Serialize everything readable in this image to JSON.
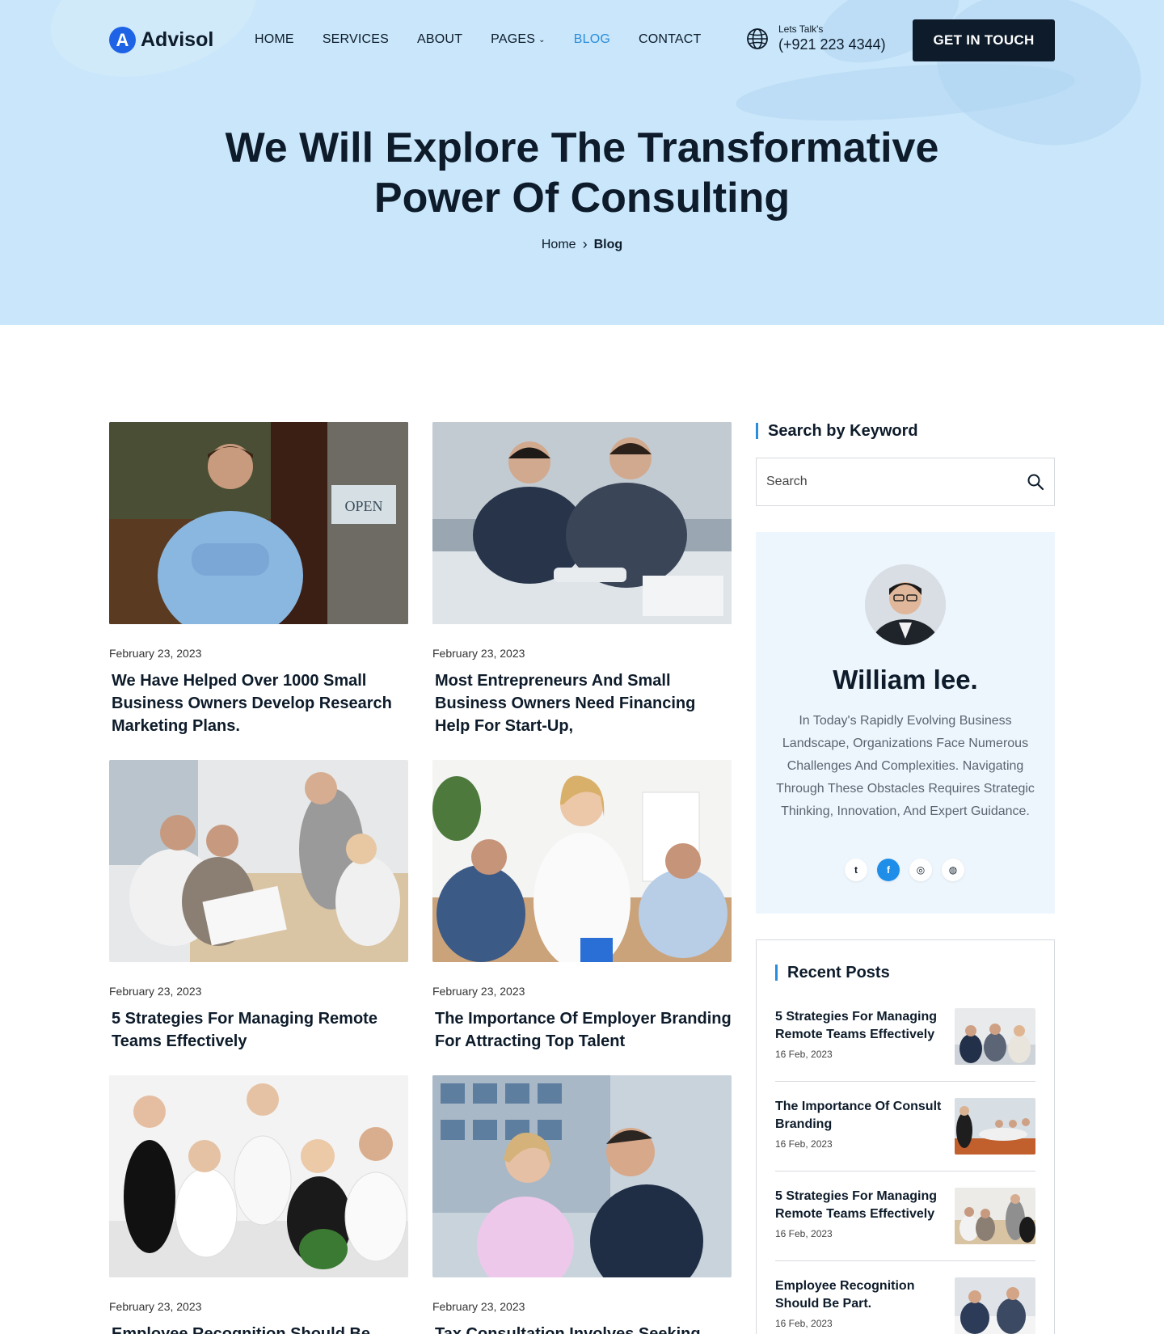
{
  "brand": {
    "mark": "A",
    "name": "Advisol"
  },
  "nav": [
    {
      "label": "HOME"
    },
    {
      "label": "SERVICES"
    },
    {
      "label": "ABOUT"
    },
    {
      "label": "PAGES",
      "dropdown": true
    },
    {
      "label": "BLOG",
      "active": true
    },
    {
      "label": "CONTACT"
    }
  ],
  "contact": {
    "label": "Lets Talk's",
    "phone": "(+921 223 4344)"
  },
  "cta": "GET IN TOUCH",
  "hero": {
    "title_line1": "We Will Explore The Transformative",
    "title_line2": "Power Of Consulting",
    "breadcrumb_home": "Home",
    "breadcrumb_current": "Blog"
  },
  "posts": [
    {
      "date": "February 23, 2023",
      "title": "We Have Helped Over 1000 Small Business Owners Develop Research Marketing Plans."
    },
    {
      "date": "February 23, 2023",
      "title": "Most Entrepreneurs And Small Business Owners Need Financing Help For Start-Up,"
    },
    {
      "date": "February 23, 2023",
      "title": "5 Strategies For Managing Remote Teams Effectively"
    },
    {
      "date": "February 23, 2023",
      "title": "The Importance Of Employer Branding For Attracting Top Talent"
    },
    {
      "date": "February 23, 2023",
      "title": "Employee Recognition Should Be"
    },
    {
      "date": "February 23, 2023",
      "title": "Tax Consultation Involves Seeking"
    }
  ],
  "sidebar": {
    "search_heading": "Search by Keyword",
    "search_placeholder": "Search",
    "author": {
      "name": "William lee.",
      "bio": "In Today's Rapidly Evolving Business Landscape, Organizations Face Numerous Challenges And Complexities. Navigating Through These Obstacles Requires Strategic Thinking, Innovation, And Expert Guidance."
    },
    "socials": [
      {
        "icon": "twitter-icon",
        "glyph": "t"
      },
      {
        "icon": "facebook-icon",
        "glyph": "f",
        "active": true
      },
      {
        "icon": "instagram-icon",
        "glyph": "◎"
      },
      {
        "icon": "github-icon",
        "glyph": "◍"
      }
    ],
    "recent_heading": "Recent Posts",
    "recent": [
      {
        "title": "5 Strategies For Managing Remote Teams Effectively",
        "date": "16 Feb, 2023"
      },
      {
        "title": "The Importance Of Consult Branding",
        "date": "16 Feb, 2023"
      },
      {
        "title": "5 Strategies For Managing Remote Teams Effectively",
        "date": "16 Feb, 2023"
      },
      {
        "title": " Employee Recognition Should Be Part.",
        "date": "16 Feb, 2023"
      }
    ]
  },
  "colors": {
    "hero_bg": "#c9e6fa",
    "accent": "#2a8ddb",
    "dark": "#0d1b2a",
    "logo_blue": "#1e63e6"
  }
}
